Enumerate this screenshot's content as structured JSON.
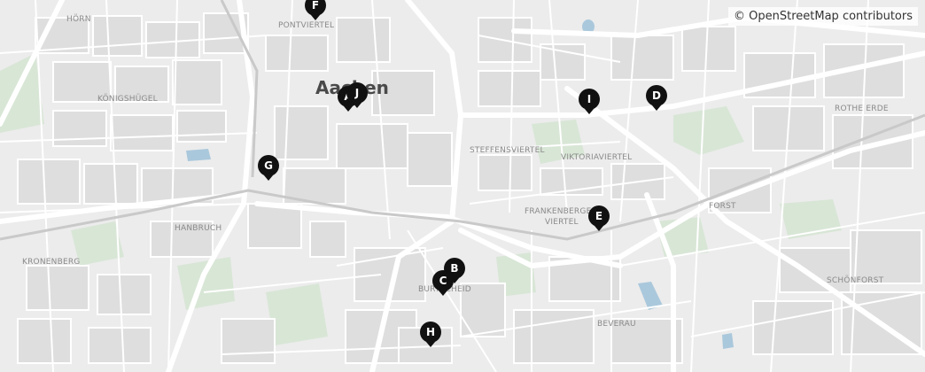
{
  "attribution": "© OpenStreetMap contributors",
  "city_label": "Aachen",
  "district_labels": [
    {
      "id": "horn",
      "text": "HÖRN"
    },
    {
      "id": "pontviertel",
      "text": "PONTVIERTEL"
    },
    {
      "id": "koenigshuegel",
      "text": "KÖNIGSHÜGEL"
    },
    {
      "id": "steffensviertel",
      "text": "STEFFENSVIERTEL"
    },
    {
      "id": "viktoriaviertel",
      "text": "VIKTORIAVIERTEL"
    },
    {
      "id": "rothe-erde",
      "text": "ROTHE ERDE"
    },
    {
      "id": "frankenberger-1",
      "text": "FRANKENBERGER"
    },
    {
      "id": "frankenberger-2",
      "text": "VIERTEL"
    },
    {
      "id": "forst",
      "text": "FORST"
    },
    {
      "id": "hanbruch",
      "text": "HANBRUCH"
    },
    {
      "id": "kronenberg",
      "text": "KRONENBERG"
    },
    {
      "id": "burtscheid",
      "text": "BURTSCHEID"
    },
    {
      "id": "schoenforst",
      "text": "SCHÖNFORST"
    },
    {
      "id": "beverau",
      "text": "BEVERAU"
    }
  ],
  "markers": [
    {
      "id": "F",
      "label": "F"
    },
    {
      "id": "A",
      "label": "A"
    },
    {
      "id": "J",
      "label": "J"
    },
    {
      "id": "I",
      "label": "I"
    },
    {
      "id": "D",
      "label": "D"
    },
    {
      "id": "G",
      "label": "G"
    },
    {
      "id": "E",
      "label": "E"
    },
    {
      "id": "B",
      "label": "B"
    },
    {
      "id": "C",
      "label": "C"
    },
    {
      "id": "H",
      "label": "H"
    }
  ],
  "colors": {
    "background": "#ececec",
    "block": "#dedede",
    "road": "#ffffff",
    "park": "#d8e6d6",
    "water": "#aac8dc",
    "marker": "#111111",
    "marker_text": "#ffffff"
  }
}
